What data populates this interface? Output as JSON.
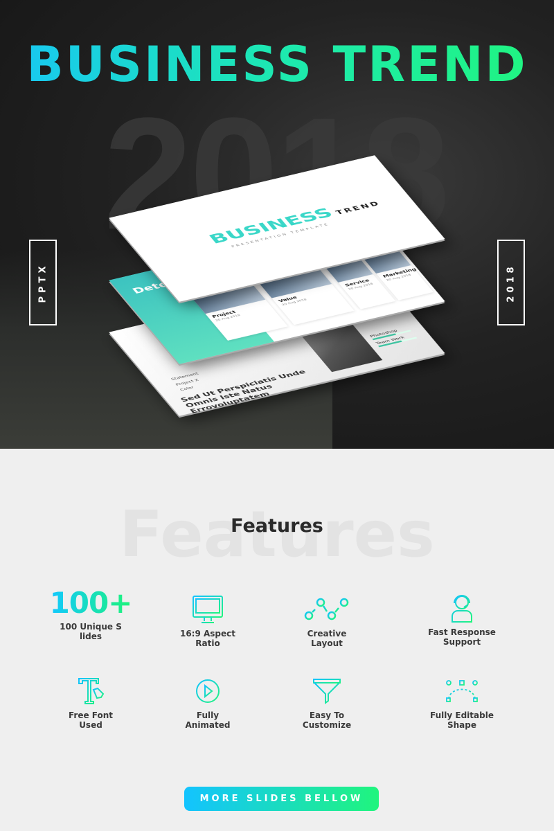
{
  "hero": {
    "title": "BUSINESS TREND",
    "ghost_year": "2018",
    "left_tag": "PPTX",
    "right_tag": "2018"
  },
  "slides": {
    "cover": {
      "logo": "BUSINESS",
      "logo_suffix": "TREND",
      "subtitle": "PRESENTATION TEMPLATE"
    },
    "cards": {
      "heading": "Determine For Your B",
      "items": [
        {
          "title": "Project",
          "date": "20 Aug 2018"
        },
        {
          "title": "Value",
          "date": "20 Aug 2018"
        },
        {
          "title": "Service",
          "date": "20 Aug 2018"
        },
        {
          "title": "Marketing",
          "date": "20 Aug 2018"
        }
      ]
    },
    "quote": {
      "text": "Sed Ut Perspiciatis Unde Omnis Iste Natus Errovoluptatem",
      "checks": [
        "Statement",
        "Project X",
        "Color"
      ],
      "skills": [
        "Photoshop",
        "Team Work"
      ]
    }
  },
  "features": {
    "ghost": "Features",
    "title": "Features",
    "items": [
      {
        "icon": "100-plus",
        "big": "100+",
        "label": "100 Unique S\nlides"
      },
      {
        "icon": "monitor-icon",
        "label": "16:9 Aspect\nRatio"
      },
      {
        "icon": "line-graph-icon",
        "label": "Creative\nLayout"
      },
      {
        "icon": "support-agent-icon",
        "label": "Fast Response\nSupport"
      },
      {
        "icon": "font-pen-icon",
        "label": "Free Font\nUsed"
      },
      {
        "icon": "play-icon",
        "label": "Fully\nAnimated"
      },
      {
        "icon": "funnel-icon",
        "label": "Easy To\nCustomize"
      },
      {
        "icon": "bezier-icon",
        "label": "Fully Editable\nShape"
      }
    ]
  },
  "cta": {
    "label": "MORE SLIDES BELLOW"
  },
  "colors": {
    "gradient_start": "#13c3ff",
    "gradient_end": "#20f57d",
    "bg": "#efefef"
  }
}
